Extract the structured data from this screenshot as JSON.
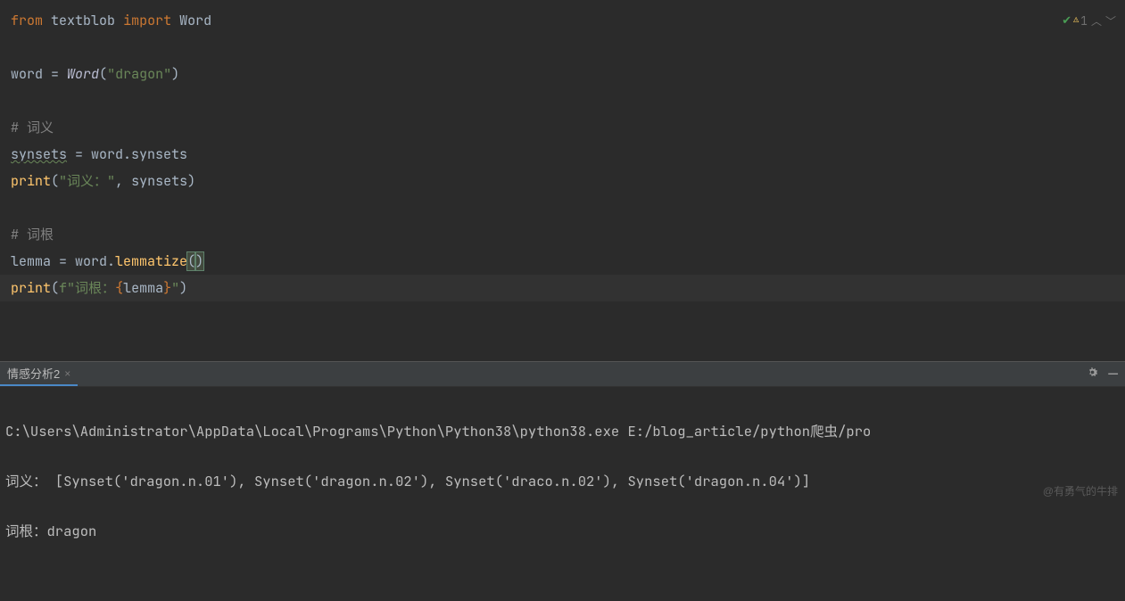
{
  "status": {
    "problems_count": "1"
  },
  "code": {
    "l1": {
      "kw1": "from",
      "mod": "textblob",
      "kw2": "import",
      "cls": "Word"
    },
    "l3": {
      "var": "word",
      "eq": " = ",
      "call": "Word",
      "open": "(",
      "str": "\"dragon\"",
      "close": ")"
    },
    "l5": {
      "comment": "# 词义"
    },
    "l6": {
      "var": "synsets",
      "eq": " = ",
      "obj": "word.",
      "attr": "synsets"
    },
    "l7": {
      "fn": "print",
      "open": "(",
      "str": "\"词义：\"",
      "comma": ", ",
      "arg": "synsets",
      "close": ")"
    },
    "l9": {
      "comment": "# 词根"
    },
    "l10": {
      "var": "lemma",
      "eq": " = ",
      "obj": "word.",
      "method": "lemmatize",
      "open": "(",
      "close": ")"
    },
    "l11": {
      "fn": "print",
      "open": "(",
      "fpre": "f",
      "str1": "\"词根：",
      "braceo": "{",
      "expr": "lemma",
      "bracec": "}",
      "str2": "\"",
      "close": ")"
    }
  },
  "tab": {
    "label": "情感分析2",
    "close": "×"
  },
  "console": {
    "line1": "C:\\Users\\Administrator\\AppData\\Local\\Programs\\Python\\Python38\\python38.exe E:/blog_article/python爬虫/pro",
    "line2": "词义： [Synset('dragon.n.01'), Synset('dragon.n.02'), Synset('draco.n.02'), Synset('dragon.n.04')]",
    "line3": "词根：dragon"
  },
  "watermark": "@有勇气的牛排"
}
